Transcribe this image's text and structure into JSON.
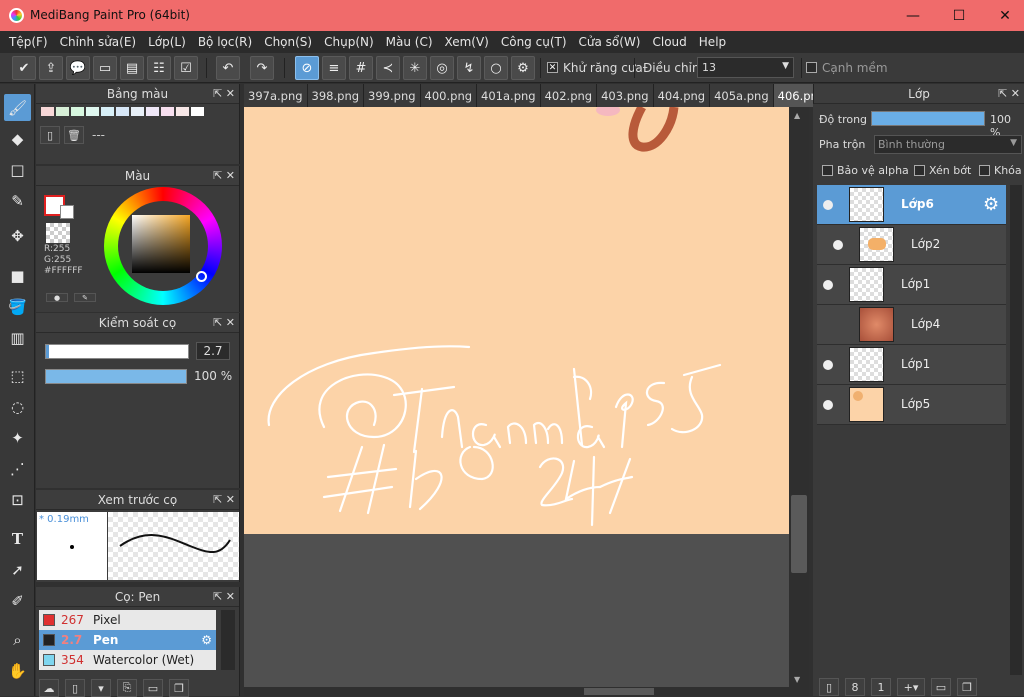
{
  "app": {
    "title": "MediBang Paint Pro (64bit)"
  },
  "menu": [
    "Tệp(F)",
    "Chỉnh sửa(E)",
    "Lớp(L)",
    "Bộ lọc(R)",
    "Chọn(S)",
    "Chụp(N)",
    "Màu (C)",
    "Xem(V)",
    "Công cụ(T)",
    "Cửa sổ(W)",
    "Cloud",
    "Help"
  ],
  "toolbar": {
    "antialias_label": "Khử răng cưa",
    "correction_label": "Điều chỉnh",
    "correction_value": "13",
    "soft_edge_label": "Cạnh mềm"
  },
  "palette": {
    "title": "Bảng màu",
    "name": "---"
  },
  "color": {
    "title": "Màu",
    "r": "R:255",
    "g": "G:255",
    "hex": "#FFFFFF"
  },
  "brush_control": {
    "title": "Kiểm soát cọ",
    "size": "2.7",
    "opacity": "100 %",
    "size_fraction": 0.02,
    "opacity_fraction": 1.0
  },
  "brush_preview": {
    "title": "Xem trước cọ",
    "size": "* 0.19mm"
  },
  "brushes": {
    "title": "Cọ: Pen",
    "items": [
      {
        "size": "267",
        "name": "Pixel",
        "color": "#e03030"
      },
      {
        "size": "2.7",
        "name": "Pen",
        "color": "#222222"
      },
      {
        "size": "354",
        "name": "Watercolor (Wet)",
        "color": "#7fd6ef"
      }
    ]
  },
  "tabs": [
    "397a.png",
    "398.png",
    "399.png",
    "400.png",
    "401a.png",
    "402.png",
    "403.png",
    "404.png",
    "405a.png",
    "406.png"
  ],
  "active_tab": "406.png",
  "canvas": {
    "background": "#fcd3a8"
  },
  "layers_panel": {
    "title": "Lớp",
    "opacity_label": "Độ trong",
    "opacity_value": "100 %",
    "blend_label": "Pha trộn",
    "blend_value": "Bình thường",
    "protect_alpha": "Bảo vệ alpha",
    "clip": "Xén bớt",
    "lock": "Khóa",
    "layers": [
      {
        "name": "Lớp6"
      },
      {
        "name": "Lớp2"
      },
      {
        "name": "Lớp1"
      },
      {
        "name": "Lớp4"
      },
      {
        "name": "Lớp1"
      },
      {
        "name": "Lớp5"
      }
    ]
  }
}
